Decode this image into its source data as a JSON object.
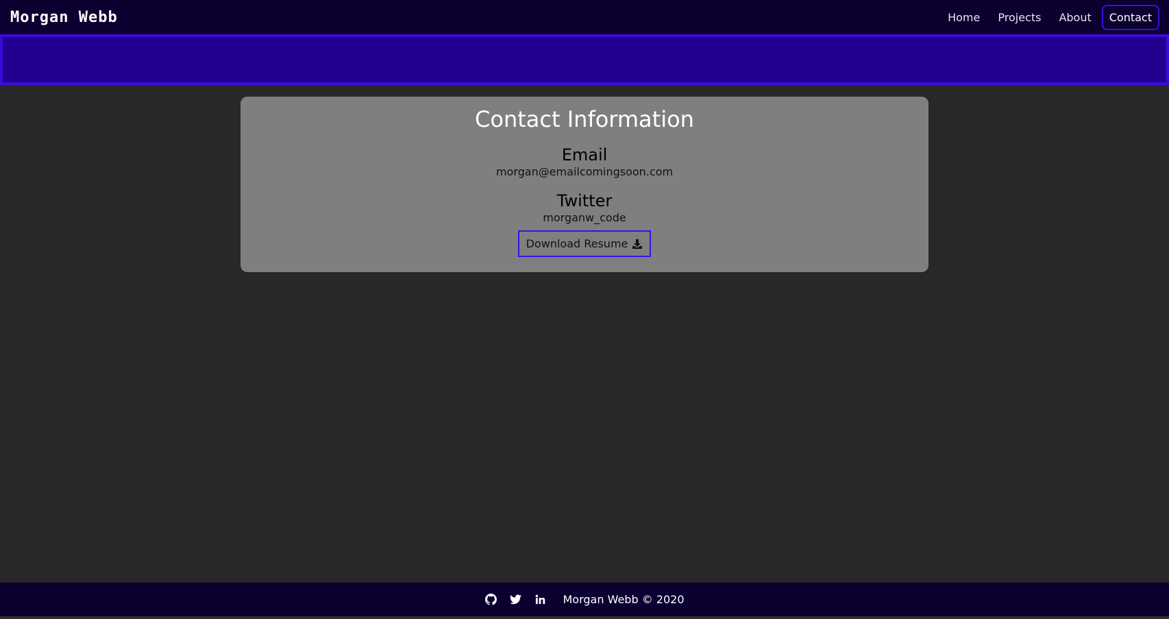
{
  "navbar": {
    "brand": "Morgan Webb",
    "links": [
      {
        "label": "Home"
      },
      {
        "label": "Projects"
      },
      {
        "label": "About"
      },
      {
        "label": "Contact",
        "active": true
      }
    ]
  },
  "contact": {
    "title": "Contact Information",
    "email_heading": "Email",
    "email_value": "morgan@emailcomingsoon.com",
    "twitter_heading": "Twitter",
    "twitter_value": "morganw_code",
    "download_label": "Download Resume",
    "download_icon": "download-icon"
  },
  "footer": {
    "icons": [
      "github-icon",
      "twitter-icon",
      "linkedin-icon"
    ],
    "text": "Morgan Webb © 2020"
  },
  "colors": {
    "nav_bg": "#0b0030",
    "banner_bg": "#23008f",
    "banner_border": "#3a0cdb",
    "page_bg": "#282828",
    "card_bg": "#7f7f7f",
    "accent": "#3a10e0"
  }
}
